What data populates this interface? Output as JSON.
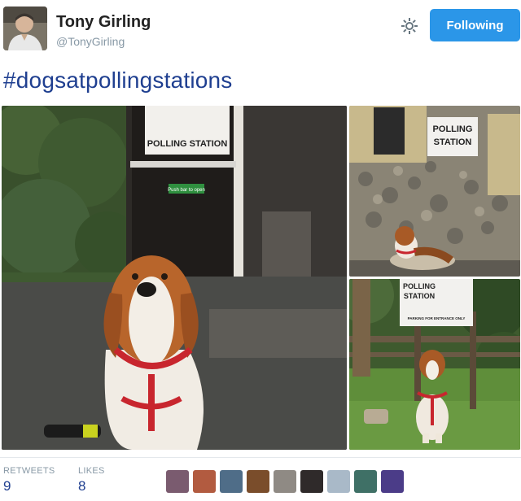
{
  "tweet": {
    "author_name": "Tony Girling",
    "author_handle": "@TonyGirling",
    "follow_label": "Following",
    "text": "#dogsatpollingstations"
  },
  "photos": {
    "main_sign": "POLLING STATION",
    "main_notice": "Push bar to open",
    "top_sign_1": "POLLING",
    "top_sign_2": "STATION",
    "bottom_sign_1": "POLLING",
    "bottom_sign_2": "STATION",
    "bottom_sign_3": "PARKING FOR ENTRANCE ONLY"
  },
  "stats": {
    "retweets_label": "RETWEETS",
    "retweets_value": "9",
    "likes_label": "LIKES",
    "likes_value": "8"
  },
  "colors": {
    "follow_button": "#2b96e8",
    "link_text": "#1f3f90"
  },
  "icons": [
    "gear-icon"
  ]
}
